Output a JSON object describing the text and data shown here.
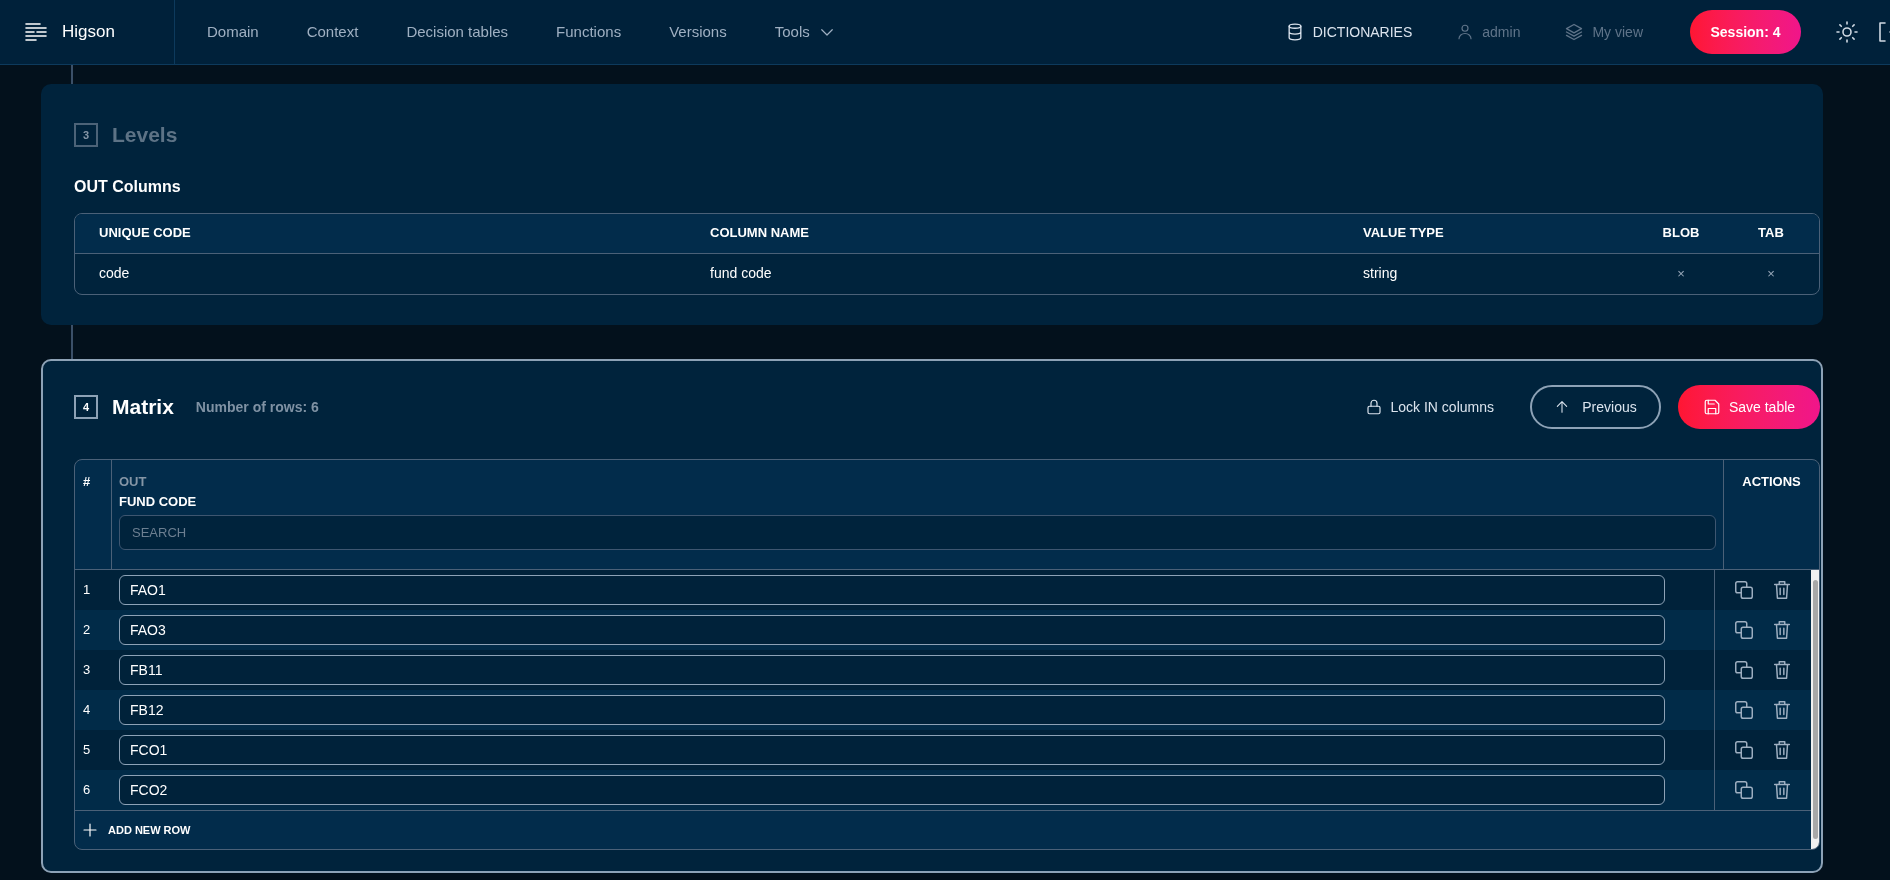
{
  "nav": {
    "brand": "Higson",
    "items": [
      {
        "label": "Domain",
        "kind": "link",
        "selected": false
      },
      {
        "label": "Context",
        "kind": "link",
        "selected": false
      },
      {
        "label": "Decision tables",
        "kind": "link",
        "selected": false
      },
      {
        "label": "Functions",
        "kind": "link",
        "selected": false
      },
      {
        "label": "Versions",
        "kind": "link",
        "selected": false
      },
      {
        "label": "Tools",
        "kind": "dropdown",
        "selected": false
      }
    ],
    "dictionaries": "DICTIONARIES",
    "user": "admin",
    "my_view": "My view",
    "session": "Session: 4"
  },
  "levels": {
    "step": "3",
    "title": "Levels",
    "active": false,
    "subtitle": "OUT Columns",
    "columns": [
      "UNIQUE CODE",
      "COLUMN NAME",
      "VALUE TYPE",
      "BLOB",
      "TAB"
    ],
    "rows": [
      {
        "cells": [
          "code",
          "fund code",
          "string",
          "×",
          "×"
        ]
      }
    ]
  },
  "matrix": {
    "step": "4",
    "title": "Matrix",
    "active": true,
    "row_count": "Number of rows: 6",
    "lock": "Lock IN columns",
    "previous": "Previous",
    "save": "Save table",
    "hash_header": "#",
    "group": "OUT",
    "column": "FUND CODE",
    "search": {
      "placeholder": "SEARCH"
    },
    "actions_header": "ACTIONS",
    "rows": [
      {
        "number": "1",
        "value": "FAO1"
      },
      {
        "number": "2",
        "value": "FAO3"
      },
      {
        "number": "3",
        "value": "FB11"
      },
      {
        "number": "4",
        "value": "FB12"
      },
      {
        "number": "5",
        "value": "FCO1"
      },
      {
        "number": "6",
        "value": "FCO2"
      }
    ],
    "add_row": "ADD NEW ROW"
  }
}
